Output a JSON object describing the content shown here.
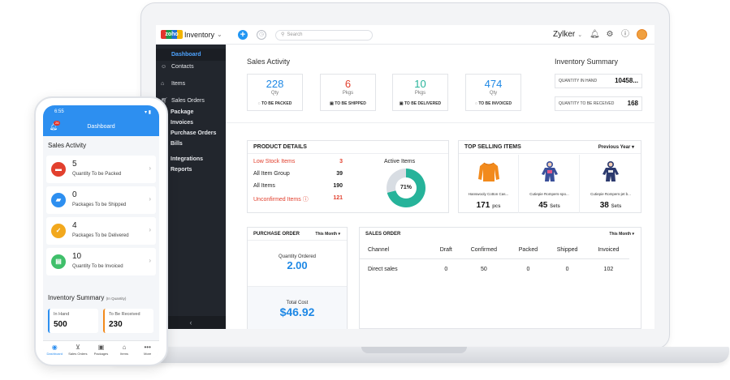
{
  "app": {
    "logo_badge": "zoho",
    "logo_text": "Inventory",
    "search_placeholder": "Search",
    "org_name": "Zylker",
    "colors": {
      "accent": "#2196f3",
      "sidebar": "#22262d",
      "danger": "#e2402e",
      "teal": "#26b39a"
    }
  },
  "sidebar": {
    "items": [
      {
        "label": "Dashboard",
        "icon": "dashboard-icon"
      },
      {
        "label": "Contacts",
        "icon": "contacts-icon"
      },
      {
        "label": "Items",
        "icon": "items-icon"
      },
      {
        "label": "Sales Orders",
        "icon": "sales-orders-icon"
      }
    ],
    "subitems": [
      "Package",
      "Invoices",
      "Purchase Orders",
      "Bills"
    ],
    "subitems2": [
      "Integrations",
      "Reports"
    ],
    "collapse_glyph": "‹"
  },
  "sales_activity": {
    "title": "Sales Activity",
    "cards": [
      {
        "value": "228",
        "unit": "Qty",
        "label": "TO BE PACKED",
        "color": "#1e88e5"
      },
      {
        "value": "6",
        "unit": "Pkgs",
        "label": "TO BE SHIPPED",
        "color": "#e2402e"
      },
      {
        "value": "10",
        "unit": "Pkgs",
        "label": "TO BE DELIVERED",
        "color": "#26b39a"
      },
      {
        "value": "474",
        "unit": "Qty",
        "label": "TO BE INVOICED",
        "color": "#1e88e5"
      }
    ]
  },
  "inventory_summary": {
    "title": "Inventory Summary",
    "rows": [
      {
        "label": "QUANTITY IN HAND",
        "value": "10458..."
      },
      {
        "label": "QUANTITY TO BE RECEIVED",
        "value": "168"
      }
    ]
  },
  "product_details": {
    "title": "PRODUCT DETAILS",
    "rows": [
      {
        "label": "Low Stock Items",
        "value": "3",
        "highlight": true
      },
      {
        "label": "All Item Group",
        "value": "39",
        "highlight": false
      },
      {
        "label": "All Items",
        "value": "190",
        "highlight": false
      },
      {
        "label": "Unconfirmed Items",
        "value": "121",
        "highlight": true
      }
    ],
    "active_items_label": "Active Items",
    "active_items_percent_label": "71%",
    "active_items_fraction": 0.71
  },
  "top_selling": {
    "title": "TOP SELLING ITEMS",
    "period": "Previous Year",
    "items": [
      {
        "name": "Hanswooly Cotton Cas...",
        "qty": "171",
        "unit": "pcs",
        "color": "#f28a1c"
      },
      {
        "name": "Cutiepie Rompers-spo...",
        "qty": "45",
        "unit": "Sets",
        "color": "#3a4f9a"
      },
      {
        "name": "Cutiepie Rompers-jet b...",
        "qty": "38",
        "unit": "Sets",
        "color": "#2c3a6e"
      }
    ]
  },
  "purchase_order": {
    "title": "PURCHASE ORDER",
    "period": "This Month",
    "qty_label": "Quantity Ordered",
    "qty_value": "2.00",
    "cost_label": "Total Cost",
    "cost_value": "$46.92"
  },
  "sales_order": {
    "title": "SALES ORDER",
    "period": "This Month",
    "columns": [
      "Channel",
      "Draft",
      "Confirmed",
      "Packed",
      "Shipped",
      "Invoiced"
    ],
    "rows": [
      [
        "Direct sales",
        "0",
        "50",
        "0",
        "0",
        "102"
      ]
    ]
  },
  "phone": {
    "time": "6:55",
    "title": "Dashboard",
    "badge": "26",
    "sales_activity_title": "Sales Activity",
    "cards": [
      {
        "value": "5",
        "label": "Quantity To be Packed",
        "color": "#e2402e",
        "icon": "box-icon"
      },
      {
        "value": "0",
        "label": "Packages To be Shipped",
        "color": "#2d8ff0",
        "icon": "truck-icon"
      },
      {
        "value": "4",
        "label": "Packages To be Delivered",
        "color": "#f2a81d",
        "icon": "check-icon"
      },
      {
        "value": "10",
        "label": "Quantity To be Invoiced",
        "color": "#3fbf6a",
        "icon": "invoice-icon"
      }
    ],
    "inv_title": "Inventory Summary",
    "inv_subtitle": "(In Quantity)",
    "inv": [
      {
        "label": "In Hand",
        "value": "500",
        "color": "#2d8ff0"
      },
      {
        "label": "To Be Received",
        "value": "230",
        "color": "#f28a1c"
      }
    ],
    "tabs": [
      {
        "label": "Dashboard",
        "icon": "dashboard-icon"
      },
      {
        "label": "Sales Orders",
        "icon": "cart-icon"
      },
      {
        "label": "Packages",
        "icon": "package-icon"
      },
      {
        "label": "Items",
        "icon": "items-icon"
      },
      {
        "label": "More",
        "icon": "more-icon"
      }
    ]
  }
}
